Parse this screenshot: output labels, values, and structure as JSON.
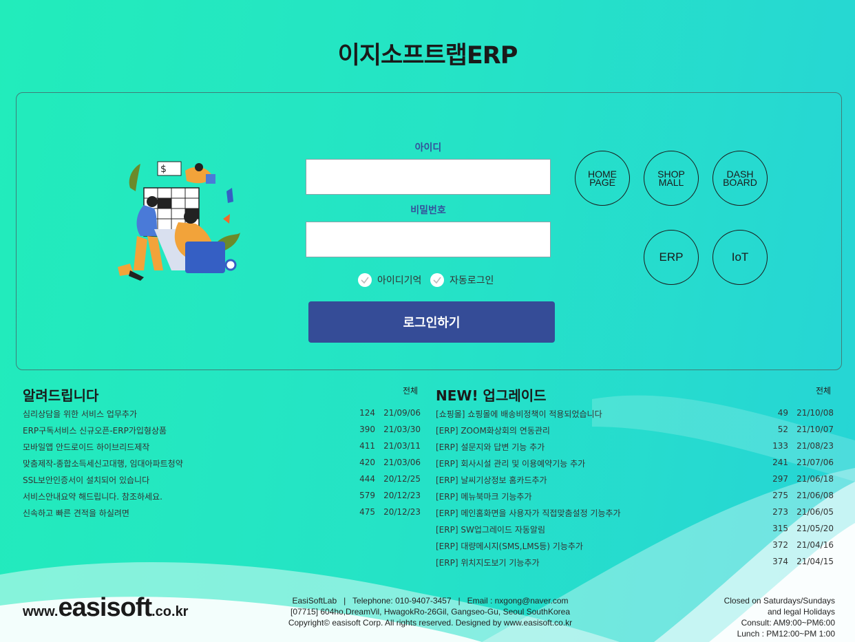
{
  "page": {
    "title": "이지소프트랩ERP"
  },
  "login": {
    "id_label": "아이디",
    "id_value": "",
    "pw_label": "비밀번호",
    "pw_value": "",
    "remember_id": "아이디기억",
    "auto_login": "자동로그인",
    "submit": "로그인하기"
  },
  "shortcuts": {
    "homepage": "HOME\nPAGE",
    "shopmall": "SHOP\nMALL",
    "dashboard": "DASH\nBOARD",
    "erp": "ERP",
    "iot": "IoT"
  },
  "notices": {
    "title": "알려드립니다",
    "all": "전체",
    "items": [
      {
        "title": "심리상담을 위한 서비스 업무추가",
        "count": "124",
        "date": "21/09/06"
      },
      {
        "title": "ERP구독서비스 신규오픈-ERP가입형상품",
        "count": "390",
        "date": "21/03/30"
      },
      {
        "title": "모바일앱 안드로이드 하이브리드제작",
        "count": "411",
        "date": "21/03/11"
      },
      {
        "title": "맞춤제작-종합소득세신고대행, 임대아파트청약",
        "count": "420",
        "date": "21/03/06"
      },
      {
        "title": "SSL보안인증서이 설치되어 있습니다",
        "count": "444",
        "date": "20/12/25"
      },
      {
        "title": "서비스안내요약 해드립니다. 참조하세요.",
        "count": "579",
        "date": "20/12/23"
      },
      {
        "title": "신속하고 빠른 견적을 하실려면",
        "count": "475",
        "date": "20/12/23"
      }
    ]
  },
  "upgrades": {
    "title": "NEW! 업그레이드",
    "all": "전체",
    "items": [
      {
        "title": "[쇼핑몰] 쇼핑몰에 배송비정책이 적용되었습니다",
        "count": "49",
        "date": "21/10/08"
      },
      {
        "title": "[ERP] ZOOM화상회의 연동관리",
        "count": "52",
        "date": "21/10/07"
      },
      {
        "title": "[ERP] 설문지와 답변 기능 추가",
        "count": "133",
        "date": "21/08/23"
      },
      {
        "title": "[ERP] 회사시설 관리 및 이용예약기능 추가",
        "count": "241",
        "date": "21/07/06"
      },
      {
        "title": "[ERP] 날씨기상정보 홈카드추가",
        "count": "297",
        "date": "21/06/18"
      },
      {
        "title": "[ERP] 메뉴북마크 기능추가",
        "count": "275",
        "date": "21/06/08"
      },
      {
        "title": "[ERP] 메인홈화면을 사용자가 직접맞춤설정 기능추가",
        "count": "273",
        "date": "21/06/05"
      },
      {
        "title": "[ERP] SW업그레이드 자동알림",
        "count": "315",
        "date": "21/05/20"
      },
      {
        "title": "[ERP] 대량메시지(SMS,LMS등) 기능추가",
        "count": "372",
        "date": "21/04/16"
      },
      {
        "title": "[ERP] 위치지도보기 기능추가",
        "count": "374",
        "date": "21/04/15"
      }
    ]
  },
  "footer": {
    "logo_prefix": "www.",
    "logo_main": "easisoft",
    "logo_suffix": ".co.kr",
    "line1": "EasiSoftLab   |   Telephone: 010-9407-3457   |   Email : nxgong@naver.com",
    "line2": "[07715] 604ho,DreamVil, HwagokRo-26Gil, Gangseo-Gu, Seoul SouthKorea",
    "line3": "Copyright© easisoft Corp. All rights reserved. Designed by www.easisoft.co.kr",
    "hours1": "Closed on Saturdays/Sundays",
    "hours2": "and legal Holidays",
    "hours3": "Consult: AM9:00~PM6:00",
    "hours4": "Lunch : PM12:00~PM 1:00"
  },
  "colors": {
    "primary_button": "#354c97",
    "label_blue": "#35509a",
    "bg_start": "#22ecbb",
    "bg_end": "#26d4d6"
  }
}
